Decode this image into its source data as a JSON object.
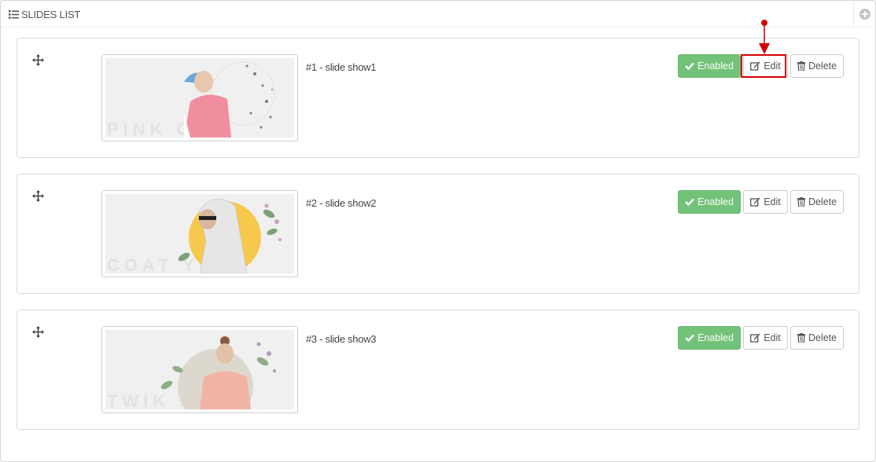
{
  "panel": {
    "title": "SLIDES LIST"
  },
  "slides": [
    {
      "label": "#1 - slide show1",
      "status_label": "Enabled",
      "edit_label": "Edit",
      "delete_label": "Delete",
      "thumb_text": "PINK C"
    },
    {
      "label": "#2 - slide show2",
      "status_label": "Enabled",
      "edit_label": "Edit",
      "delete_label": "Delete",
      "thumb_text": "COAT      Y"
    },
    {
      "label": "#3 - slide show3",
      "status_label": "Enabled",
      "edit_label": "Edit",
      "delete_label": "Delete",
      "thumb_text": "TWIK        HE"
    }
  ],
  "icons": {
    "header": "list-icon",
    "add": "plus-circle-icon",
    "drag": "move-arrows-icon",
    "enabled": "check-icon",
    "edit": "edit-icon",
    "delete": "trash-icon"
  },
  "colors": {
    "enabled_button": "#72c279",
    "highlight": "#d10000",
    "border": "#d6d6d6"
  }
}
